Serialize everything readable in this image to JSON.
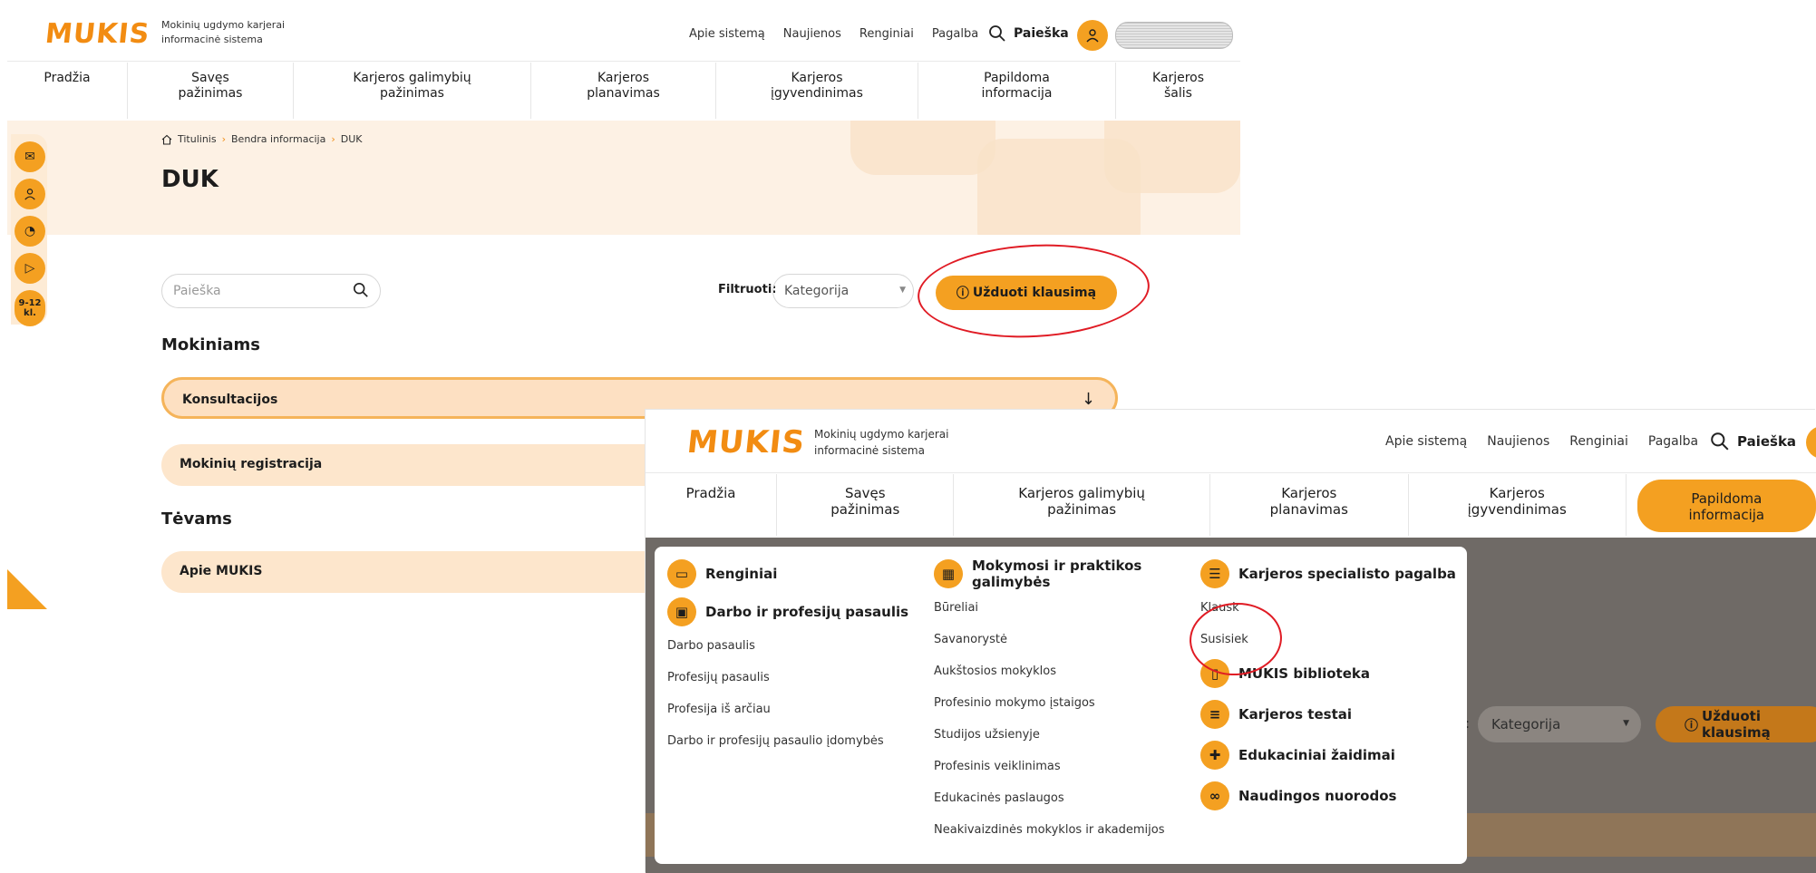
{
  "brand": {
    "logo": "MUKIS",
    "tagline_1": "Mokinių ugdymo karjerai",
    "tagline_2": "informacinė sistema"
  },
  "top_links": [
    "Apie sistemą",
    "Naujienos",
    "Renginiai",
    "Pagalba"
  ],
  "search_label": "Paieška",
  "main_nav": [
    {
      "l1": "Pradžia",
      "l2": ""
    },
    {
      "l1": "Savęs",
      "l2": "pažinimas"
    },
    {
      "l1": "Karjeros galimybių",
      "l2": "pažinimas"
    },
    {
      "l1": "Karjeros",
      "l2": "planavimas"
    },
    {
      "l1": "Karjeros",
      "l2": "įgyvendinimas"
    },
    {
      "l1": "Papildoma",
      "l2": "informacija"
    },
    {
      "l1": "Karjeros",
      "l2": "šalis"
    }
  ],
  "breadcrumb": [
    "Titulinis",
    "Bendra informacija",
    "DUK"
  ],
  "page_title": "DUK",
  "side_tools": {
    "grade_1": "9-12",
    "grade_2": "kl."
  },
  "search_placeholder": "Paieška",
  "filter_label": "Filtruoti:",
  "filter_value": "Kategorija",
  "ask_button": "Užduoti klausimą",
  "sections": [
    {
      "title": "Mokiniams",
      "items": [
        "Konsultacijos",
        "Mokinių registracija"
      ]
    },
    {
      "title": "Tėvams",
      "items": [
        "Apie MUKIS"
      ]
    }
  ],
  "mega_menu": {
    "col1": {
      "head1": "Renginiai",
      "head2": "Darbo ir profesijų pasaulis",
      "links": [
        "Darbo pasaulis",
        "Profesijų pasaulis",
        "Profesija iš arčiau",
        "Darbo ir profesijų pasaulio įdomybės"
      ]
    },
    "col2": {
      "head": "Mokymosi ir praktikos galimybės",
      "links": [
        "Būreliai",
        "Savanorystė",
        "Aukštosios mokyklos",
        "Profesinio mokymo įstaigos",
        "Studijos užsienyje",
        "Profesinis veiklinimas",
        "Edukacinės paslaugos",
        "Neakivaizdinės mokyklos ir akademijos"
      ]
    },
    "col3": {
      "head": "Karjeros specialisto pagalba",
      "links": [
        "Klausk",
        "Susisiek"
      ],
      "heads": [
        "MUKIS biblioteka",
        "Karjeros testai",
        "Edukaciniai žaidimai",
        "Naudingos nuorodos"
      ]
    }
  },
  "colors": {
    "accent": "#f4a021",
    "banner": "#fdf1e4",
    "annotation": "#e01b24"
  }
}
